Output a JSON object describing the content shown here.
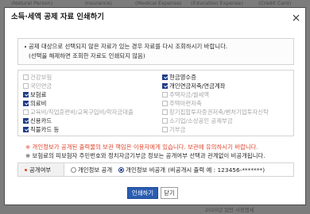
{
  "colors": {
    "overlay": "#7c7c7c",
    "accent": "#2a5db0",
    "checkbox_checked": "#1f3c88",
    "notice": "#e0442b"
  },
  "background": {
    "header_columns": [
      "(Natural Person)",
      "Insurance)",
      "(Medical Expense)",
      "(Education Expense)",
      "(Credit Card)"
    ],
    "footer_text": "2020년 일반 사용명세"
  },
  "dialog": {
    "title": "소득·세액 공제 자료 인쇄하기",
    "close_icon": "close-icon",
    "info": {
      "line1": "공제 대상으로 선택되지 않은 자료가 있는 경우 자료를 다시 조회하시기 바랍니다.",
      "line2": "(선택을 해제하면 조회한 자료도 인쇄되지 않음)"
    },
    "items_left": [
      {
        "label": "건강보험",
        "checked": false
      },
      {
        "label": "국민연금",
        "checked": false
      },
      {
        "label": "보험료",
        "checked": true
      },
      {
        "label": "의료비",
        "checked": true
      },
      {
        "label": "교육비/직업훈련비/교복구입비/학자금대출",
        "checked": false
      },
      {
        "label": "신용카드",
        "checked": true
      },
      {
        "label": "직불카드 등",
        "checked": true
      }
    ],
    "items_right": [
      {
        "label": "현금영수증",
        "checked": true
      },
      {
        "label": "개인연금저축/연금계좌",
        "checked": true
      },
      {
        "label": "주택자금/월세액",
        "checked": false
      },
      {
        "label": "주택마련저축",
        "checked": false
      },
      {
        "label": "장기집합투자증권저축/벤처기업투자신탁",
        "checked": false
      },
      {
        "label": "소기업/소상공인 공제부금",
        "checked": false
      },
      {
        "label": "기부금",
        "checked": false
      }
    ],
    "notices": [
      "※ 개인정보가 공개된 출력물의 보관 책임은 이용자에게 있습니다. 보관에 유의하시기 바랍니다.",
      "※ 보험료의 피보험자 주민번호와 정치자금기부금 정보는 공개여부 선택과 관계없이 비공개됩니다."
    ],
    "disclosure": {
      "label": "공개여부",
      "options": [
        {
          "label": "개인정보 공개",
          "selected": false
        },
        {
          "label": "개인정보 비공개",
          "selected": true
        }
      ],
      "example": "(비공개시 출력 예 : 123456-*******)"
    },
    "buttons": {
      "print": "인쇄하기",
      "close": "닫기"
    }
  }
}
